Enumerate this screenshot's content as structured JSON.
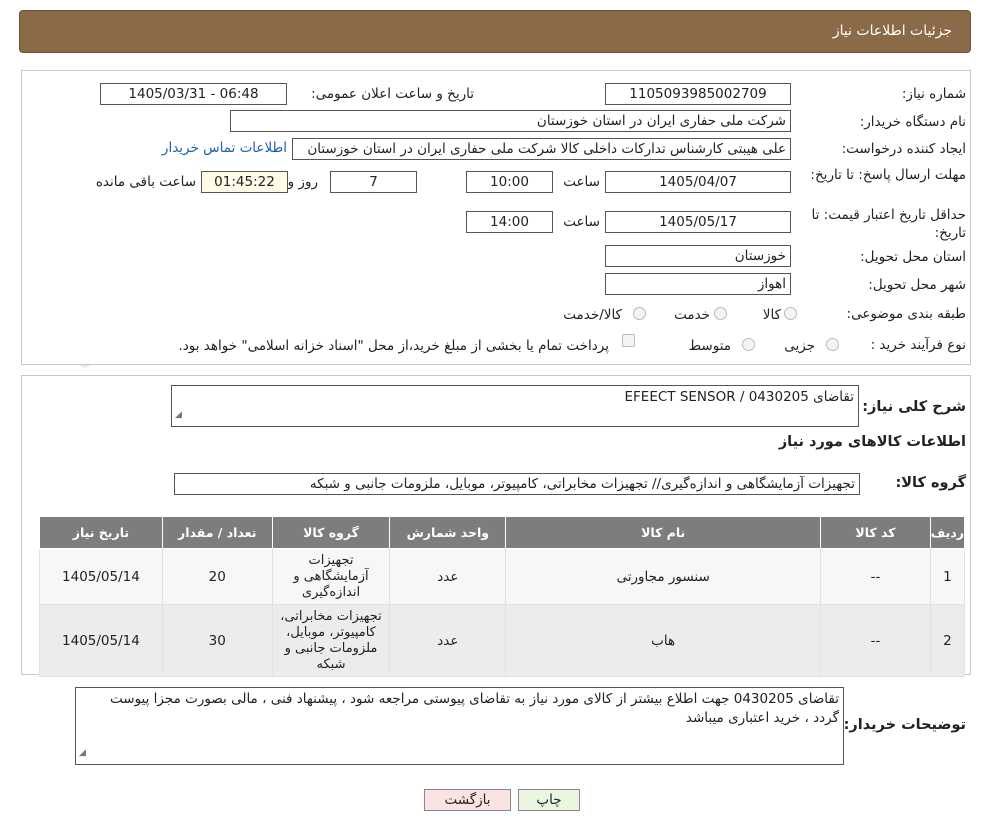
{
  "header": {
    "title": "جزئیات اطلاعات نیاز"
  },
  "form": {
    "need_number_label": "شماره نیاز:",
    "need_number": "1105093985002709",
    "announce_label": "تاریخ و ساعت اعلان عمومی:",
    "announce_value": "1405/03/31 - 06:48",
    "buyer_org_label": "نام دستگاه خریدار:",
    "buyer_org": "شرکت ملی حفاری ایران در استان خوزستان",
    "requester_label": "ایجاد کننده درخواست:",
    "requester": "علی هیبتی کارشناس تدارکات داخلی کالا شرکت ملی حفاری ایران در استان خوزستان",
    "contact_link": "اطلاعات تماس خریدار",
    "reply_deadline_label": "مهلت ارسال پاسخ: تا تاریخ:",
    "reply_date": "1405/04/07",
    "time_label": "ساعت",
    "reply_time": "10:00",
    "days_value": "7",
    "days_label": "روز و",
    "remaining_time": "01:45:22",
    "remaining_label": "ساعت باقی مانده",
    "validity_label": "حداقل تاریخ اعتبار قیمت: تا تاریخ:",
    "validity_date": "1405/05/17",
    "validity_time": "14:00",
    "province_label": "استان محل تحویل:",
    "province": "خوزستان",
    "city_label": "شهر محل تحویل:",
    "city": "اهواز",
    "category_label": "طبقه بندی موضوعی:",
    "category_options": [
      "کالا",
      "خدمت",
      "کالا/خدمت"
    ],
    "process_label": "نوع فرآیند خرید :",
    "process_options": [
      "جزیی",
      "متوسط"
    ],
    "payment_note": "پرداخت تمام یا بخشی از مبلغ خرید،از محل \"اسناد خزانه اسلامی\" خواهد بود."
  },
  "summary": {
    "desc_label": "شرح کلی نیاز:",
    "desc_value": "تقاضای EFEECT SENSOR / 0430205",
    "items_heading": "اطلاعات کالاهای مورد نیاز",
    "group_label": "گروه کالا:",
    "group_value": "تجهیزات آزمایشگاهی و اندازه‌گیری// تجهیزات مخابراتی، کامپیوتر، موبایل، ملزومات جانبی و شبکه"
  },
  "table": {
    "headers": [
      "ردیف",
      "کد کالا",
      "نام کالا",
      "واحد شمارش",
      "گروه کالا",
      "تعداد / مقدار",
      "تاریخ نیاز"
    ],
    "rows": [
      [
        "1",
        "--",
        "سنسور مجاورتی",
        "عدد",
        "تجهیزات آزمایشگاهی و اندازه‌گیری",
        "20",
        "1405/05/14"
      ],
      [
        "2",
        "--",
        "هاب",
        "عدد",
        "تجهیزات مخابراتی، کامپیوتر، موبایل، ملزومات جانبی و شبکه",
        "30",
        "1405/05/14"
      ]
    ]
  },
  "notes": {
    "label": "توضیحات خریدار:",
    "value": "تقاضای 0430205 جهت اطلاع بیشتر از کالای مورد نیاز به تقاضای پیوستی مراجعه شود ، پیشنهاد فنی ، مالی بصورت مجزا پیوست گردد ، خرید اعتباری میباشد"
  },
  "buttons": {
    "print": "چاپ",
    "back": "بازگشت"
  },
  "watermark": {
    "text": "AriaTender.neT"
  },
  "colors": {
    "header_bg": "#8b6a47",
    "link": "#1a5fb4",
    "back_button_bg": "#fbe3e3",
    "print_button_bg": "#eaf6e0"
  }
}
